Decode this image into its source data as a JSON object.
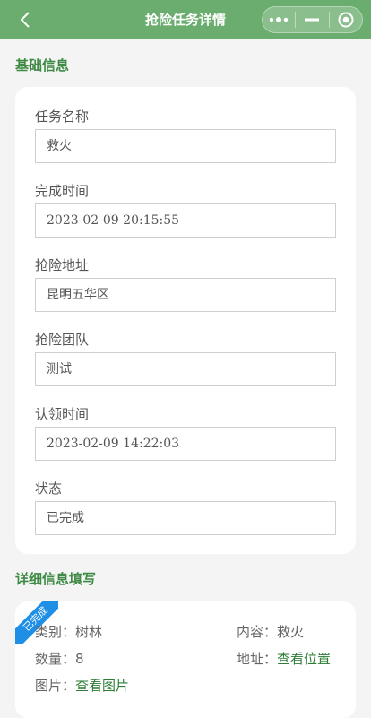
{
  "navbar": {
    "title": "抢险任务详情",
    "back_icon": "chevron-left-icon",
    "menu_icon": "more-dots-icon",
    "minimize_icon": "minus-icon",
    "close_icon": "target-circle-icon"
  },
  "basic_section": {
    "title": "基础信息",
    "fields": [
      {
        "label": "任务名称",
        "value": "救火"
      },
      {
        "label": "完成时间",
        "value": "2023-02-09 20:15:55"
      },
      {
        "label": "抢险地址",
        "value": "昆明五华区"
      },
      {
        "label": "抢险团队",
        "value": "测试"
      },
      {
        "label": "认领时间",
        "value": "2023-02-09 14:22:03"
      },
      {
        "label": "状态",
        "value": "已完成"
      }
    ]
  },
  "detail_section": {
    "title": "详细信息填写",
    "ribbon": "已完成",
    "category_label": "类别：",
    "category_value": "树林",
    "content_label": "内容：",
    "content_value": "救火",
    "quantity_label": "数量：",
    "quantity_value": "8",
    "address_label": "地址：",
    "address_link": "查看位置",
    "image_label": "图片：",
    "image_link": "查看图片"
  },
  "colors": {
    "navbar": "#6aad6e",
    "section_title": "#3f8a45",
    "link": "#2c7d34",
    "ribbon": "#1f8fe6"
  }
}
